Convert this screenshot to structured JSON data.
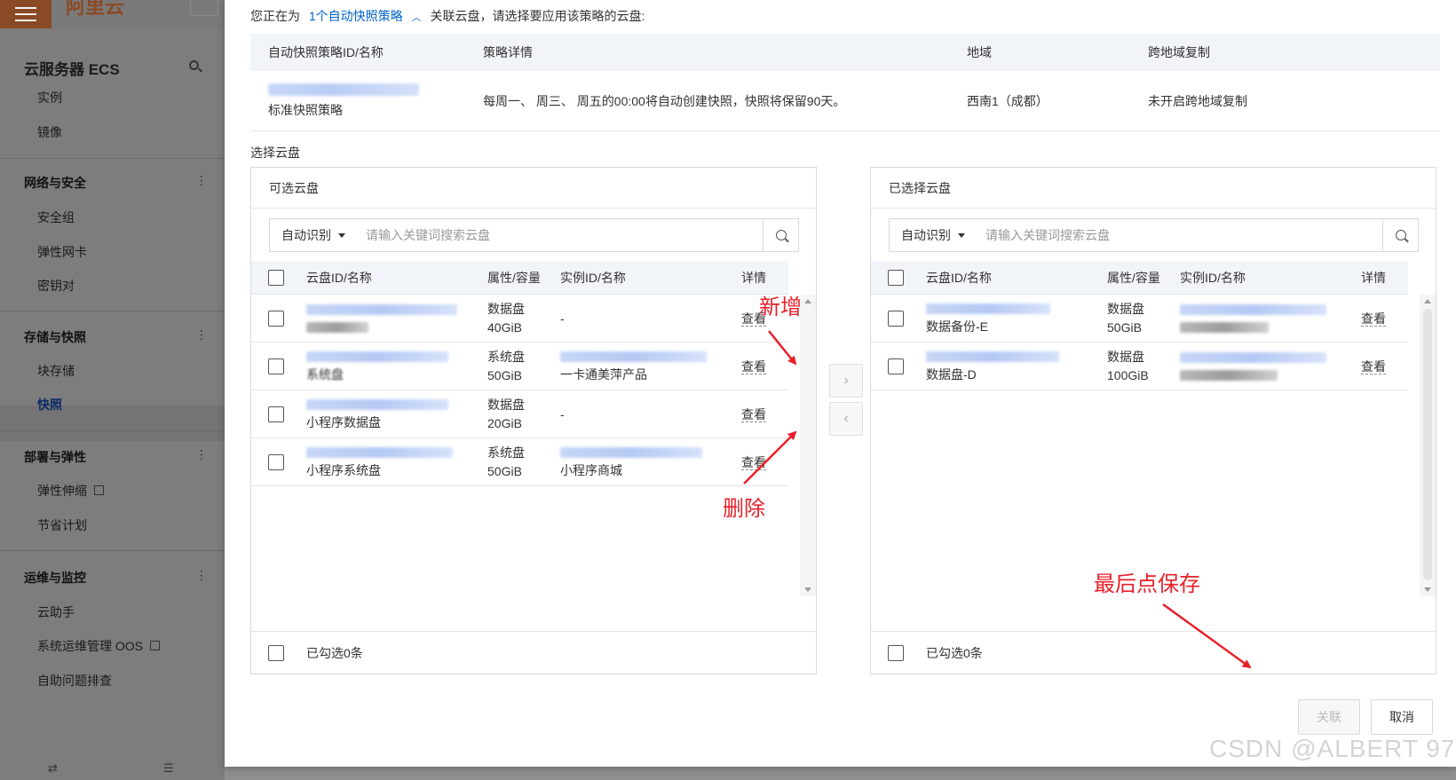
{
  "sidebar": {
    "logo": "阿里云",
    "title": "云服务器 ECS",
    "items_top": [
      "实例",
      "镜像"
    ],
    "groups": [
      {
        "title": "网络与安全",
        "items": [
          "安全组",
          "弹性网卡",
          "密钥对"
        ]
      },
      {
        "title": "存储与快照",
        "items": [
          "块存储",
          "快照"
        ],
        "active": "快照"
      },
      {
        "title": "部署与弹性",
        "items": [
          "弹性伸缩",
          "节省计划"
        ]
      },
      {
        "title": "运维与监控",
        "items": [
          "云助手",
          "系统运维管理 OOS",
          "自助问题排查"
        ]
      }
    ],
    "bottom_icons": [
      "swap-icon",
      "list-icon"
    ]
  },
  "dialog": {
    "intro_prefix": "您正在为",
    "intro_link": "1个自动快照策略",
    "intro_suffix": "关联云盘，请选择要应用该策略的云盘:",
    "policy_table": {
      "headers": [
        "自动快照策略ID/名称",
        "策略详情",
        "地域",
        "跨地域复制"
      ],
      "row": {
        "name": "标准快照策略",
        "detail": "每周一、 周三、 周五的00:00将自动创建快照，快照将保留90天。",
        "region": "西南1（成都）",
        "cross_region": "未开启跨地域复制"
      }
    },
    "select_label": "选择云盘",
    "left_panel": {
      "title": "可选云盘",
      "select_value": "自动识别",
      "search_placeholder": "请输入关键词搜索云盘",
      "headers": [
        "云盘ID/名称",
        "属性/容量",
        "实例ID/名称",
        "详情"
      ],
      "rows": [
        {
          "name": "",
          "attr": "数据盘",
          "size": "40GiB",
          "inst": "-",
          "inst_name": "",
          "detail": "查看"
        },
        {
          "name": "系统盘",
          "attr": "系统盘",
          "size": "50GiB",
          "inst": "",
          "inst_name": "一卡通美萍产品",
          "detail": "查看"
        },
        {
          "name": "小程序数据盘",
          "attr": "数据盘",
          "size": "20GiB",
          "inst": "-",
          "inst_name": "",
          "detail": "查看"
        },
        {
          "name": "小程序系统盘",
          "attr": "系统盘",
          "size": "50GiB",
          "inst": "",
          "inst_name": "小程序商城",
          "detail": "查看"
        }
      ],
      "footer": "已勾选0条"
    },
    "right_panel": {
      "title": "已选择云盘",
      "select_value": "自动识别",
      "search_placeholder": "请输入关键词搜索云盘",
      "headers": [
        "云盘ID/名称",
        "属性/容量",
        "实例ID/名称",
        "详情"
      ],
      "rows": [
        {
          "name": "数据备份-E",
          "attr": "数据盘",
          "size": "50GiB",
          "detail": "查看"
        },
        {
          "name": "数据盘-D",
          "attr": "数据盘",
          "size": "100GiB",
          "detail": "查看"
        }
      ],
      "footer": "已勾选0条"
    },
    "buttons": {
      "ok": "关联",
      "cancel": "取消"
    }
  },
  "annotations": {
    "add": "新增",
    "remove": "删除",
    "save": "最后点保存",
    "color": "#e8202a"
  },
  "watermark": "CSDN @ALBERT 97"
}
